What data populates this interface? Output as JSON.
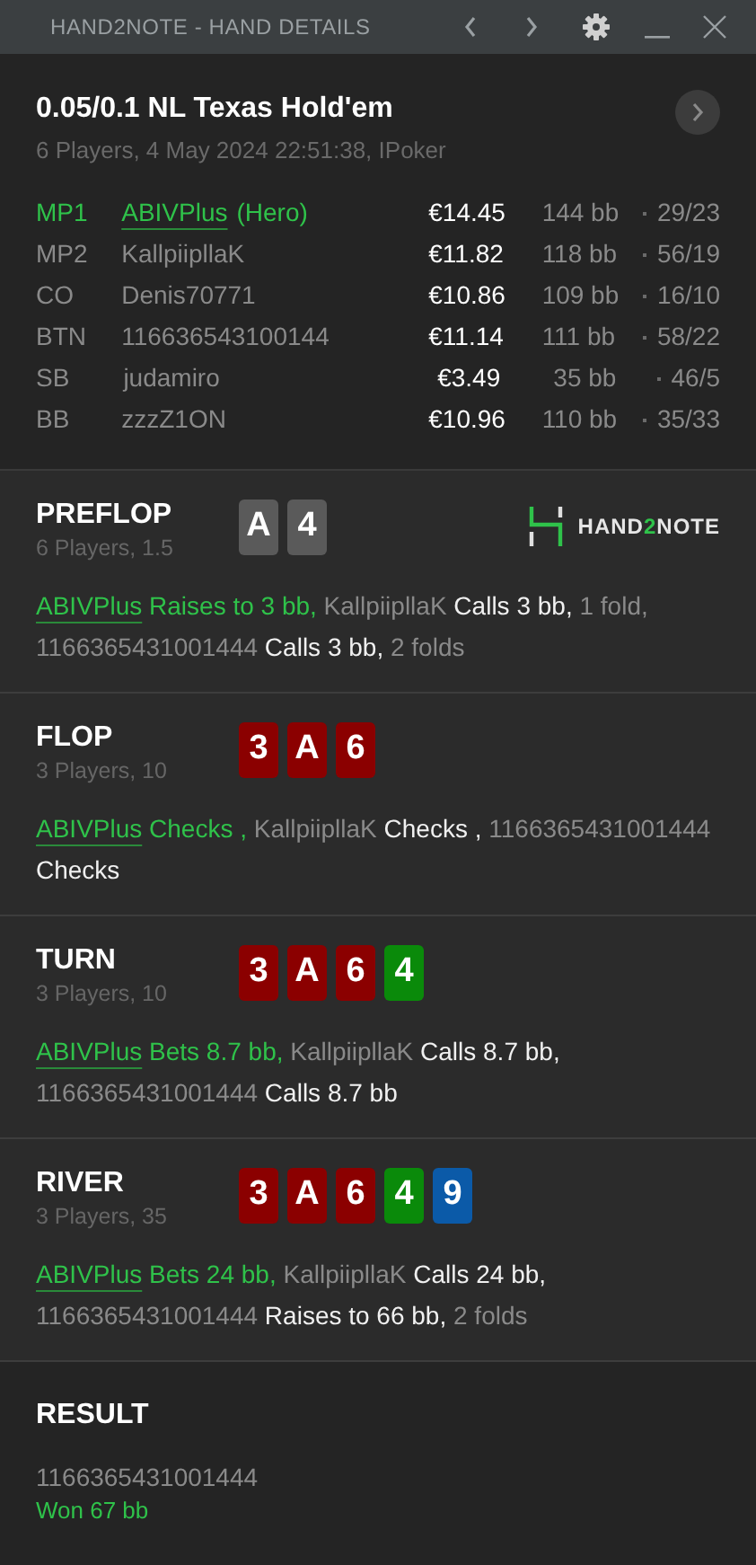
{
  "window": {
    "title": "HAND2NOTE - HAND DETAILS"
  },
  "hand": {
    "title": "0.05/0.1 NL Texas Hold'em",
    "subtitle": "6 Players, 4 May 2024 22:51:38, IPoker",
    "players": [
      {
        "position": "MP1",
        "name": "ABIVPlus",
        "hero_tag": "(Hero)",
        "hero": true,
        "stack": "€14.45",
        "bb": "144 bb",
        "stats": "29/23"
      },
      {
        "position": "MP2",
        "name": "KallpiipllaK",
        "hero": false,
        "stack": "€11.82",
        "bb": "118 bb",
        "stats": "56/19"
      },
      {
        "position": "CO",
        "name": "Denis70771",
        "hero": false,
        "stack": "€10.86",
        "bb": "109 bb",
        "stats": "16/10"
      },
      {
        "position": "BTN",
        "name": "116636543100144",
        "hero": false,
        "stack": "€11.14",
        "bb": "111 bb",
        "stats": "58/22"
      },
      {
        "position": "SB",
        "name": "judamiro",
        "hero": false,
        "stack": "€3.49",
        "bb": "35 bb",
        "stats": "46/5"
      },
      {
        "position": "BB",
        "name": "zzzZ1ON",
        "hero": false,
        "stack": "€10.96",
        "bb": "110 bb",
        "stats": "35/33"
      }
    ]
  },
  "logo": {
    "before": "HAND",
    "accent": "2",
    "after": "NOTE"
  },
  "streets": [
    {
      "name": "PREFLOP",
      "info": "6 Players, 1.5",
      "cards": [
        {
          "rank": "A",
          "color": "#5a5a5a"
        },
        {
          "rank": "4",
          "color": "#5a5a5a"
        }
      ],
      "actions": [
        {
          "kind": "hero",
          "text": "ABIVPlus"
        },
        {
          "kind": "hero_action",
          "text": " Raises to 3 bb,"
        },
        {
          "kind": "player",
          "text": " KallpiipllaK"
        },
        {
          "kind": "action",
          "text": " Calls 3 bb,"
        },
        {
          "kind": "player",
          "text": " 1 fold,"
        },
        {
          "kind": "player",
          "text": " 1166365431001444"
        },
        {
          "kind": "action",
          "text": " Calls 3 bb,"
        },
        {
          "kind": "player",
          "text": " 2 folds"
        }
      ]
    },
    {
      "name": "FLOP",
      "info": "3 Players, 10",
      "cards": [
        {
          "rank": "3",
          "color": "#8b0000"
        },
        {
          "rank": "A",
          "color": "#8b0000"
        },
        {
          "rank": "6",
          "color": "#8b0000"
        }
      ],
      "actions": [
        {
          "kind": "hero",
          "text": "ABIVPlus"
        },
        {
          "kind": "hero_action",
          "text": " Checks ,"
        },
        {
          "kind": "player",
          "text": " KallpiipllaK"
        },
        {
          "kind": "action",
          "text": " Checks ,"
        },
        {
          "kind": "player",
          "text": " 1166365431001444"
        },
        {
          "kind": "action",
          "text": " Checks"
        }
      ]
    },
    {
      "name": "TURN",
      "info": "3 Players, 10",
      "cards": [
        {
          "rank": "3",
          "color": "#8b0000"
        },
        {
          "rank": "A",
          "color": "#8b0000"
        },
        {
          "rank": "6",
          "color": "#8b0000"
        },
        {
          "rank": "4",
          "color": "#0a8a0a"
        }
      ],
      "actions": [
        {
          "kind": "hero",
          "text": "ABIVPlus"
        },
        {
          "kind": "hero_action",
          "text": " Bets 8.7 bb,"
        },
        {
          "kind": "player",
          "text": " KallpiipllaK"
        },
        {
          "kind": "action",
          "text": " Calls 8.7 bb,"
        },
        {
          "kind": "player",
          "text": " 1166365431001444"
        },
        {
          "kind": "action",
          "text": " Calls 8.7 bb"
        }
      ]
    },
    {
      "name": "RIVER",
      "info": "3 Players, 35",
      "cards": [
        {
          "rank": "3",
          "color": "#8b0000"
        },
        {
          "rank": "A",
          "color": "#8b0000"
        },
        {
          "rank": "6",
          "color": "#8b0000"
        },
        {
          "rank": "4",
          "color": "#0a8a0a"
        },
        {
          "rank": "9",
          "color": "#0b5aa8"
        }
      ],
      "actions": [
        {
          "kind": "hero",
          "text": "ABIVPlus"
        },
        {
          "kind": "hero_action",
          "text": " Bets 24 bb,"
        },
        {
          "kind": "player",
          "text": " KallpiipllaK"
        },
        {
          "kind": "action",
          "text": " Calls 24 bb,"
        },
        {
          "kind": "player",
          "text": " 1166365431001444"
        },
        {
          "kind": "action",
          "text": " Raises to 66 bb,"
        },
        {
          "kind": "player",
          "text": " 2 folds"
        }
      ]
    }
  ],
  "result": {
    "title": "RESULT",
    "winner": "1166365431001444",
    "won": "Won 67 bb"
  }
}
